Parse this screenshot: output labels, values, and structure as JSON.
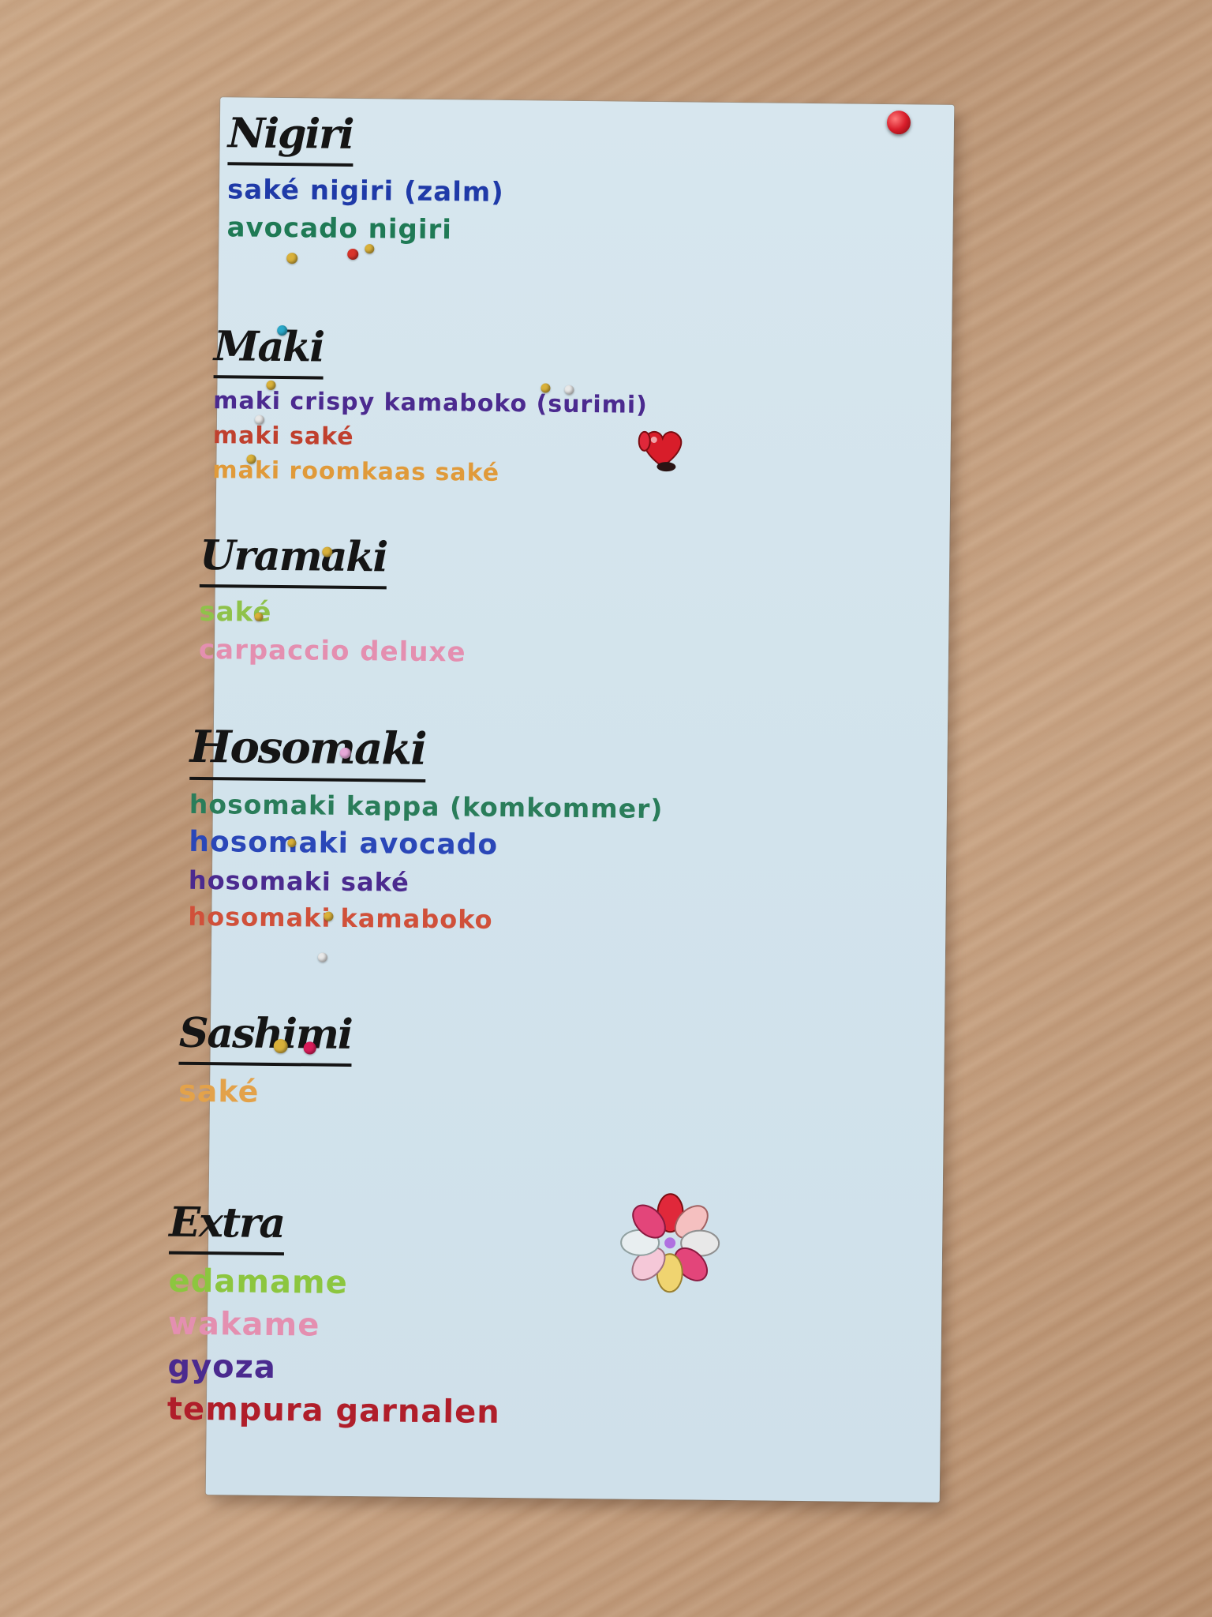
{
  "menu": {
    "sections": [
      {
        "heading": "Nigiri",
        "items": [
          {
            "text": "saké nigiri (zalm)",
            "color": "#1f3aa8"
          },
          {
            "text": "avocado nigiri",
            "color": "#1f7a55"
          }
        ]
      },
      {
        "heading": "Maki",
        "items": [
          {
            "text": "maki crispy kamaboko (surimi)",
            "color": "#4b2a8f"
          },
          {
            "text": "maki saké",
            "color": "#c0402e"
          },
          {
            "text": "maki roomkaas saké",
            "color": "#e09a3a"
          }
        ]
      },
      {
        "heading": "Uramaki",
        "items": [
          {
            "text": "saké",
            "color": "#8fc24a"
          },
          {
            "text": "carpaccio deluxe",
            "color": "#e48fb0"
          }
        ]
      },
      {
        "heading": "Hosomaki",
        "items": [
          {
            "text": "hosomaki kappa (komkommer)",
            "color": "#2a7d5a"
          },
          {
            "text": "hosomaki avocado",
            "color": "#2a47b8"
          },
          {
            "text": "hosomaki saké",
            "color": "#4b2a8f"
          },
          {
            "text": "hosomaki kamaboko",
            "color": "#d0503a"
          }
        ]
      },
      {
        "heading": "Sashimi",
        "items": [
          {
            "text": "saké",
            "color": "#e3a24a"
          }
        ]
      },
      {
        "heading": "Extra",
        "items": [
          {
            "text": "edamame",
            "color": "#8cc63f"
          },
          {
            "text": "wakame",
            "color": "#e48fb0"
          },
          {
            "text": "gyoza",
            "color": "#4b2a8f"
          },
          {
            "text": "tempura garnalen",
            "color": "#b01e2a"
          }
        ]
      }
    ]
  }
}
